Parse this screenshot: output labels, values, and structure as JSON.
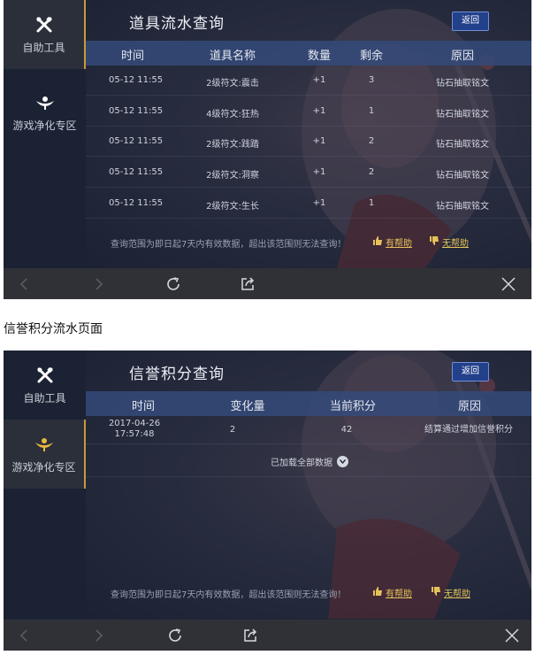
{
  "sidebar": {
    "tools_label": "自助工具",
    "clean_label": "游戏净化专区"
  },
  "panel1": {
    "title": "道具流水查询",
    "back_label": "返回",
    "columns": [
      "时间",
      "道具名称",
      "数量",
      "剩余",
      "原因"
    ],
    "rows": [
      {
        "time": "05-12 11:55",
        "name": "2级符文:震击",
        "qty": "+1",
        "remain": "3",
        "reason": "钻石抽取铭文"
      },
      {
        "time": "05-12 11:55",
        "name": "4级符文:狂热",
        "qty": "+1",
        "remain": "1",
        "reason": "钻石抽取铭文"
      },
      {
        "time": "05-12 11:55",
        "name": "2级符文:践踏",
        "qty": "+1",
        "remain": "2",
        "reason": "钻石抽取铭文"
      },
      {
        "time": "05-12 11:55",
        "name": "2级符文:洞察",
        "qty": "+1",
        "remain": "2",
        "reason": "钻石抽取铭文"
      },
      {
        "time": "05-12 11:55",
        "name": "2级符文:生长",
        "qty": "+1",
        "remain": "1",
        "reason": "钻石抽取铭文"
      }
    ],
    "note": "查询范围为即日起7天内有效数据，超出该范围则无法查询！",
    "helpful": "有帮助",
    "unhelpful": "无帮助"
  },
  "caption": "信誉积分流水页面",
  "panel2": {
    "title": "信誉积分查询",
    "back_label": "返回",
    "columns": [
      "时间",
      "变化量",
      "当前积分",
      "原因"
    ],
    "rows": [
      {
        "date": "2017-04-26",
        "clock": "17:57:48",
        "change": "2",
        "score": "42",
        "reason": "结算通过增加信誉积分"
      }
    ],
    "loaded_text": "已加载全部数据",
    "note": "查询范围为即日起7天内有效数据，超出该范围则无法查询！",
    "helpful": "有帮助",
    "unhelpful": "无帮助"
  },
  "colors": {
    "accent_gold": "#e6c25a",
    "header_blue": "#344a7a",
    "button_blue": "#23408a",
    "panel_bg": "#1f2638"
  },
  "icons": [
    "tools-icon",
    "clean-icon",
    "back-arrow-icon",
    "forward-arrow-icon",
    "refresh-icon",
    "share-icon",
    "close-icon",
    "thumbs-up-icon",
    "thumbs-down-icon",
    "chevron-down-icon"
  ]
}
